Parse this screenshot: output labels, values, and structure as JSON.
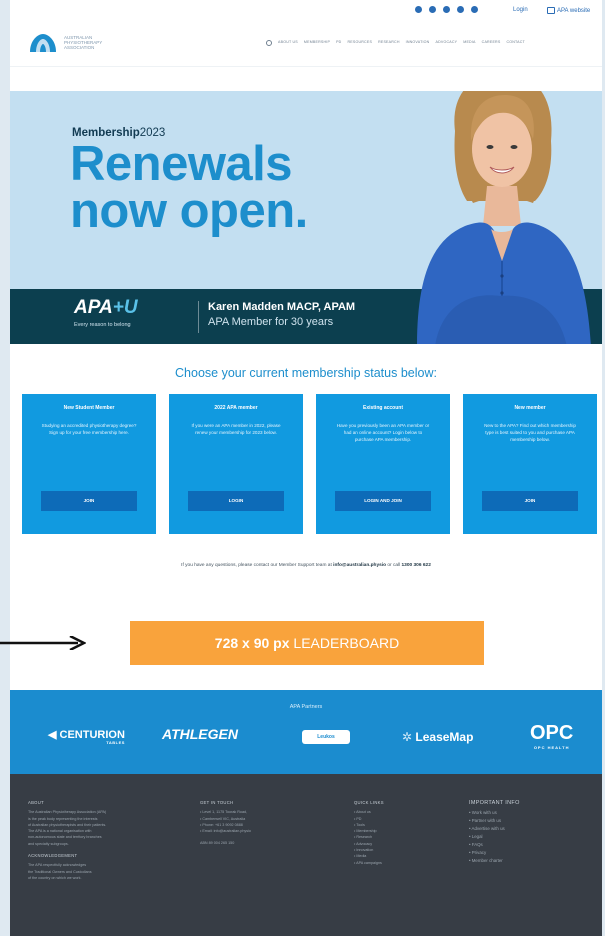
{
  "utility_bar": {
    "login": "Login",
    "apa_website": "APA website"
  },
  "header": {
    "logo_lines": [
      "AUSTRALIAN",
      "PHYSIOTHERAPY",
      "ASSOCIATION"
    ],
    "nav": [
      "ABOUT US",
      "MEMBERSHIP",
      "PD",
      "RESOURCES",
      "RESEARCH",
      "INNOVATION",
      "ADVOCACY",
      "MEDIA",
      "CAREERS",
      "CONTACT"
    ]
  },
  "hero": {
    "kicker_bold": "Membership",
    "kicker_rest": "2023",
    "headline_line1": "Renewals",
    "headline_line2": "now open.",
    "brand_main": "APA",
    "brand_plus": "+U",
    "brand_tagline": "Every reason to belong",
    "person_name": "Karen Madden MACP, APAM",
    "person_member": "APA Member for 30 years"
  },
  "status": {
    "title": "Choose your current membership status below:",
    "cards": [
      {
        "title": "New Student Member",
        "desc": "Studying an accredited physiotherapy degree? Sign up for your free membership here.",
        "button": "JOIN"
      },
      {
        "title": "2022 APA member",
        "desc": "If you were an APA member in 2022, please renew your membership for 2023 below.",
        "button": "LOGIN"
      },
      {
        "title": "Existing account",
        "desc": "Have you previously been an APA member or had an online account? Login below to purchase APA membership.",
        "button": "LOGIN AND JOIN"
      },
      {
        "title": "New member",
        "desc": "New to the APA? Find out which membership type is best suited to you and purchase APA membership below.",
        "button": "JOIN"
      }
    ],
    "contact_prefix": "If you have any questions, please contact our Member Support team at ",
    "contact_email": "info@australian.physio",
    "contact_mid": " or call ",
    "contact_phone": "1300 306 622"
  },
  "leaderboard": {
    "size": "728 x 90 px",
    "label": "LEADERBOARD"
  },
  "partners": {
    "title": "APA Partners",
    "logos": [
      "CENTURION",
      "TABLES",
      "ATHLEGEN",
      "Leukos",
      "LeaseMap",
      "OPC",
      "OPC HEALTH"
    ]
  },
  "footer": {
    "columns": [
      {
        "heading": "ABOUT",
        "lines": [
          "The Australian Physiotherapy Association (APA)",
          "is the peak body representing the interests",
          "of Australian physiotherapists and their patients.",
          "The APA is a national organisation with",
          "non-autonomous state and territory branches",
          "and specialty subgroups."
        ],
        "heading2": "ACKNOWLEDGEMENT",
        "lines2": [
          "The APA respectfully acknowledges",
          "the Traditional Owners and Custodians",
          "of the country on which we work."
        ]
      },
      {
        "heading": "GET IN TOUCH",
        "lines": [
          "•  Level 1, 1175 Toorak Road,",
          "•  Camberwell VIC, Australia",
          "•  Phone: +61 3 9092 0888",
          "•  Email: info@australian.physio"
        ],
        "heading2": "",
        "lines2": [
          "ABN 89 004 265 150"
        ]
      },
      {
        "heading": "QUICK LINKS",
        "lines": [
          "• About us",
          "• PD",
          "• Tools",
          "• Membership",
          "• Research",
          "• Advocacy",
          "• Innovation",
          "• Media",
          "• APA campaigns"
        ],
        "heading2": "",
        "lines2": []
      },
      {
        "heading": "IMPORTANT INFO",
        "lines": [
          "• Work with us",
          "• Partner with us",
          "• Advertise with us",
          "• Legal",
          "• FAQs",
          "• Privacy",
          "• Member charter"
        ],
        "heading2": "",
        "lines2": []
      }
    ]
  },
  "colors": {
    "brand_blue": "#1d8ecc",
    "card_blue": "#119ae0",
    "button_blue": "#0d6bb8",
    "hero_bg": "#c3dff1",
    "band_dark": "#0c3f4f",
    "leaderboard_orange": "#f9a33c",
    "footer_dark": "#373d45"
  }
}
